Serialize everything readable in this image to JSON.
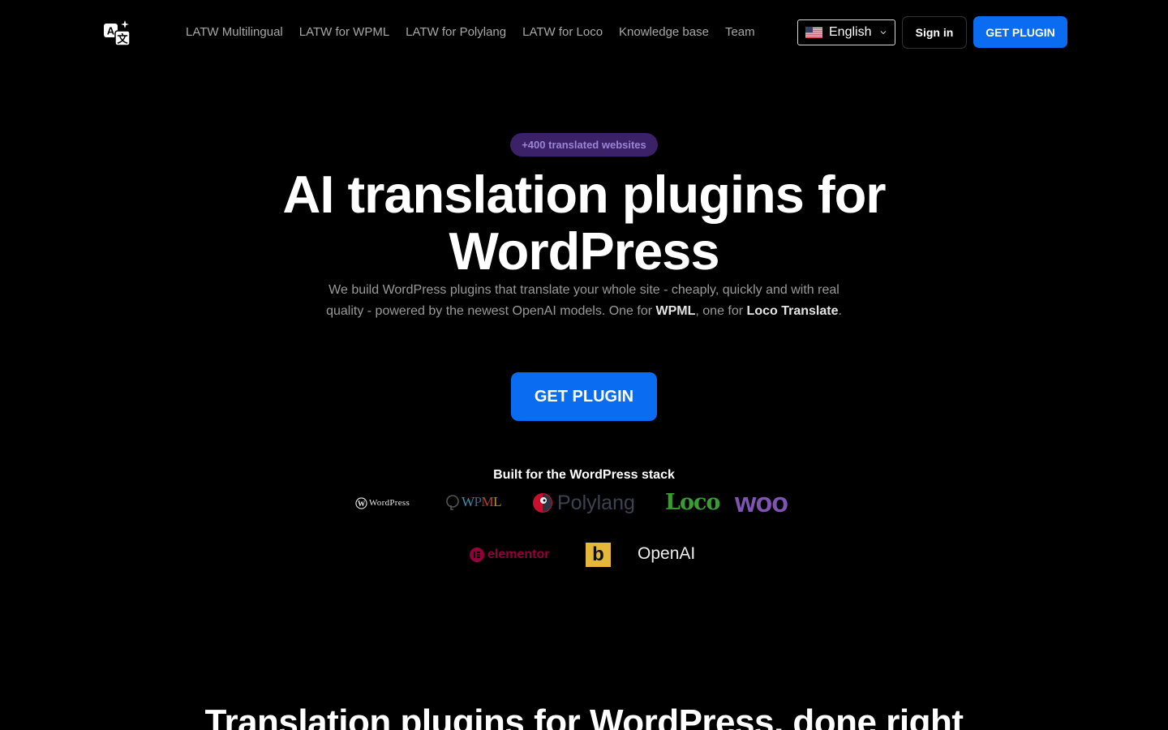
{
  "header": {
    "logo_icon": "translate-sparkle-icon",
    "nav": [
      {
        "label": "LATW Multilingual"
      },
      {
        "label": "LATW for WPML"
      },
      {
        "label": "LATW for Polylang"
      },
      {
        "label": "LATW for Loco"
      },
      {
        "label": "Knowledge base"
      },
      {
        "label": "Team"
      }
    ],
    "language": {
      "label": "English",
      "flag_icon": "us-flag-icon"
    },
    "sign_in": "Sign in",
    "get_plugin": "GET PLUGIN"
  },
  "hero": {
    "badge": "+400 translated websites",
    "headline_line1": "AI translation plugins for",
    "headline_line2": "WordPress",
    "subtext_part1": "We build WordPress plugins that translate your whole site - cheaply, quickly and with real quality - powered by the newest OpenAI models. One for ",
    "subtext_bold1": "WPML",
    "subtext_part2": ", one for ",
    "subtext_bold2": "Loco Translate",
    "subtext_part3": ".",
    "cta": "GET PLUGIN"
  },
  "stack": {
    "title": "Built for the WordPress stack",
    "logos": {
      "wordpress": "WordPress",
      "wpml": "WPML",
      "polylang": "Polylang",
      "loco": "Loco",
      "woo": "woo",
      "elementor": "elementor",
      "b": "b",
      "openai": "OpenAI"
    }
  },
  "next_section": {
    "heading": "Translation plugins for WordPress, done right"
  },
  "colors": {
    "background": "#000000",
    "accent_blue": "#0a6cf0",
    "badge_bg": "#3a2168",
    "badge_text": "#9c84d6"
  }
}
